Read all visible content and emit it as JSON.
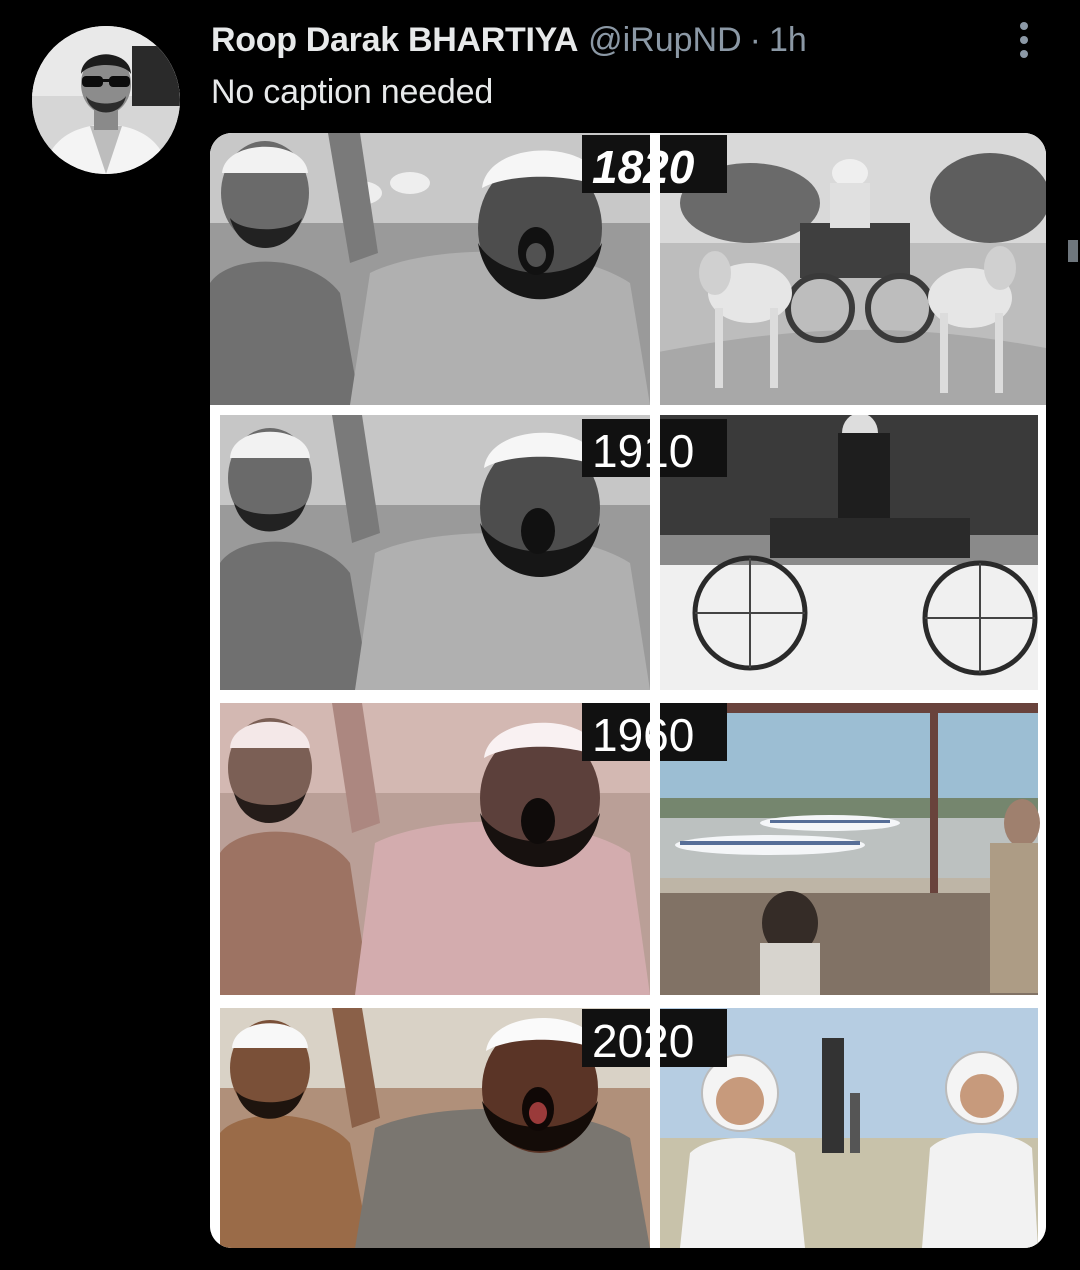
{
  "tweet": {
    "author_name": "Roop Darak BHARTIYA",
    "handle": "@iRupND",
    "separator": "·",
    "time": "1h",
    "caption": "No caption needed"
  },
  "media": {
    "rows": [
      {
        "year": "1820",
        "left_scene": "protest-crowd",
        "right_scene": "bullock-cart",
        "tint": "grayscale"
      },
      {
        "year": "1910",
        "left_scene": "protest-crowd",
        "right_scene": "early-automobile",
        "tint": "grayscale"
      },
      {
        "year": "1960",
        "left_scene": "protest-crowd",
        "right_scene": "airport-control-tower",
        "tint": "faded-color"
      },
      {
        "year": "2020",
        "left_scene": "protest-crowd",
        "right_scene": "astronauts-launch-pad",
        "tint": "color"
      }
    ]
  },
  "icons": {
    "more": "more-options-icon",
    "avatar": "profile-photo"
  },
  "colors": {
    "background": "#000000",
    "primary_text": "#e7e9ea",
    "secondary_text": "#8b98a5"
  }
}
